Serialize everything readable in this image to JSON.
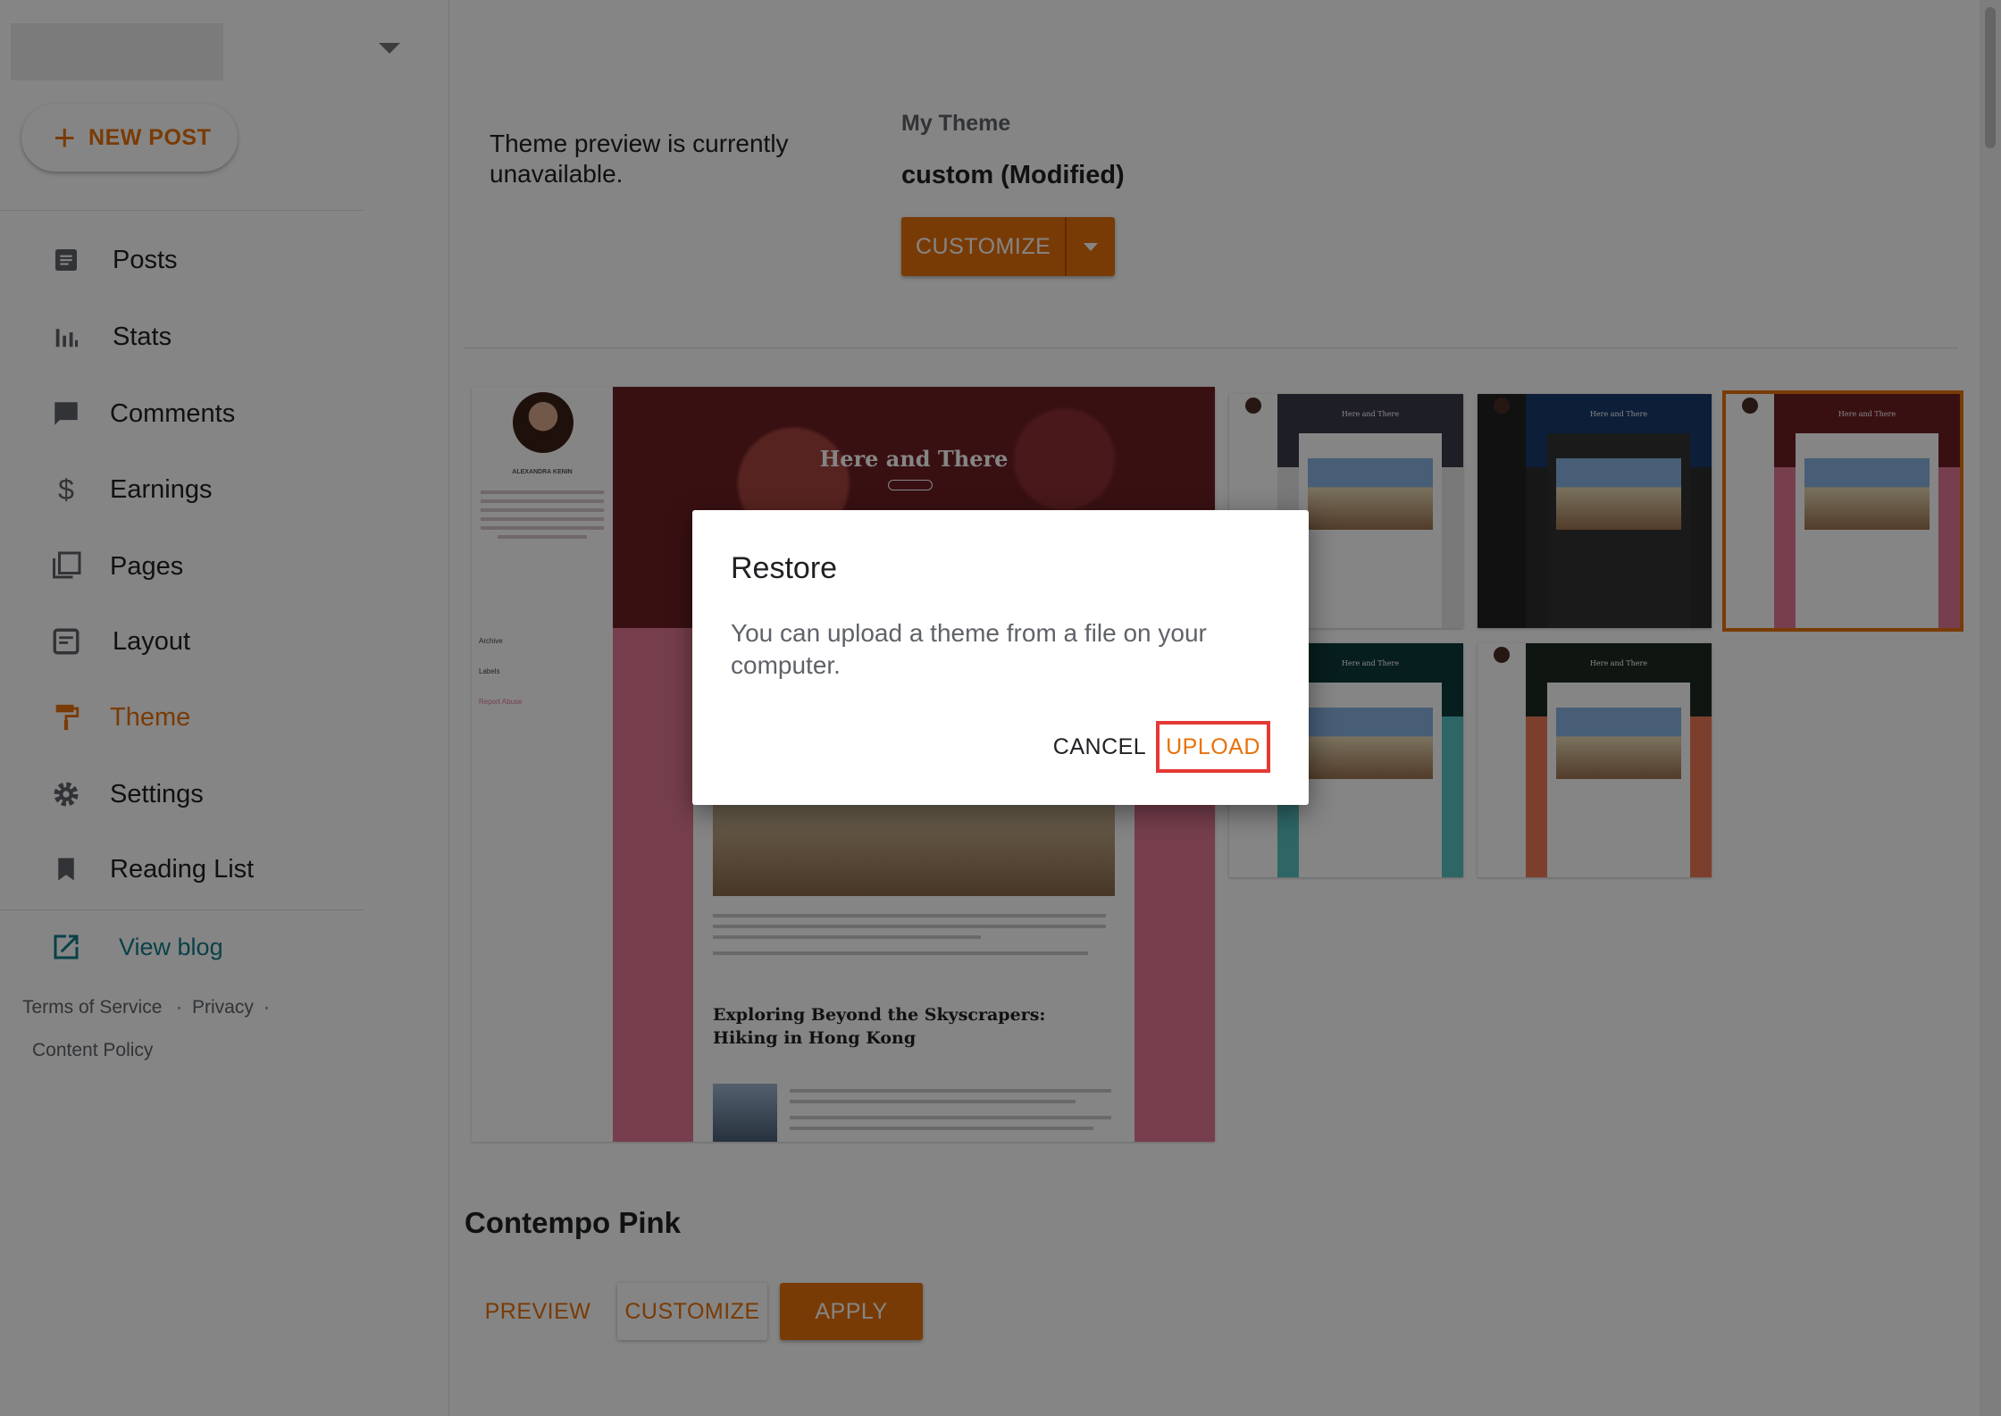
{
  "sidebar": {
    "new_post_label": "NEW POST",
    "new_post_icon": "plus-icon",
    "nav": [
      {
        "label": "Posts",
        "icon": "posts-icon"
      },
      {
        "label": "Stats",
        "icon": "stats-icon"
      },
      {
        "label": "Comments",
        "icon": "comments-icon"
      },
      {
        "label": "Earnings",
        "icon": "dollar-icon"
      },
      {
        "label": "Pages",
        "icon": "pages-icon"
      },
      {
        "label": "Layout",
        "icon": "layout-icon"
      },
      {
        "label": "Theme",
        "icon": "paint-roller-icon",
        "active": true
      },
      {
        "label": "Settings",
        "icon": "gear-icon"
      },
      {
        "label": "Reading List",
        "icon": "bookmark-icon"
      }
    ],
    "view_blog": {
      "label": "View blog",
      "icon": "open-in-new-icon"
    },
    "footer": {
      "terms": "Terms of Service",
      "privacy": "Privacy",
      "content_policy": "Content Policy",
      "separator": "·"
    }
  },
  "main": {
    "preview_message": "Theme preview is currently unavailable.",
    "my_theme_label": "My Theme",
    "my_theme_name": "custom (Modified)",
    "customize_label": "CUSTOMIZE",
    "big_preview": {
      "blog_title": "Here and There",
      "author": "ALEXANDRA KENIN",
      "archive": "Archive",
      "labels": "Labels",
      "report_abuse": "Report Abuse",
      "post_title": "Exploring Beyond the Skyscrapers: Hiking in Hong Kong"
    },
    "thumbnails": [
      {
        "title": "Here and There",
        "hero": "#3a3a4a",
        "body": "#e9e9e9"
      },
      {
        "title": "Here and There",
        "hero": "#173a6b",
        "body": "#2d2d2d"
      },
      {
        "title": "Here and There",
        "hero": "#6d1f24",
        "body": "#e57a94",
        "selected": true
      },
      {
        "title": "Here and There",
        "hero": "#0f3b3a",
        "body": "#59c3c3"
      },
      {
        "title": "Here and There",
        "hero": "#1d2b22",
        "body": "#f07a56"
      }
    ],
    "theme_name": "Contempo Pink",
    "preview_btn": "PREVIEW",
    "customize_btn": "CUSTOMIZE",
    "apply_btn": "APPLY"
  },
  "dialog": {
    "title": "Restore",
    "body": "You can upload a theme from a file on your computer.",
    "cancel": "CANCEL",
    "upload": "UPLOAD"
  },
  "colors": {
    "accent": "#e8710a",
    "teal_link": "#137d8a",
    "highlight_border": "#e53935"
  }
}
